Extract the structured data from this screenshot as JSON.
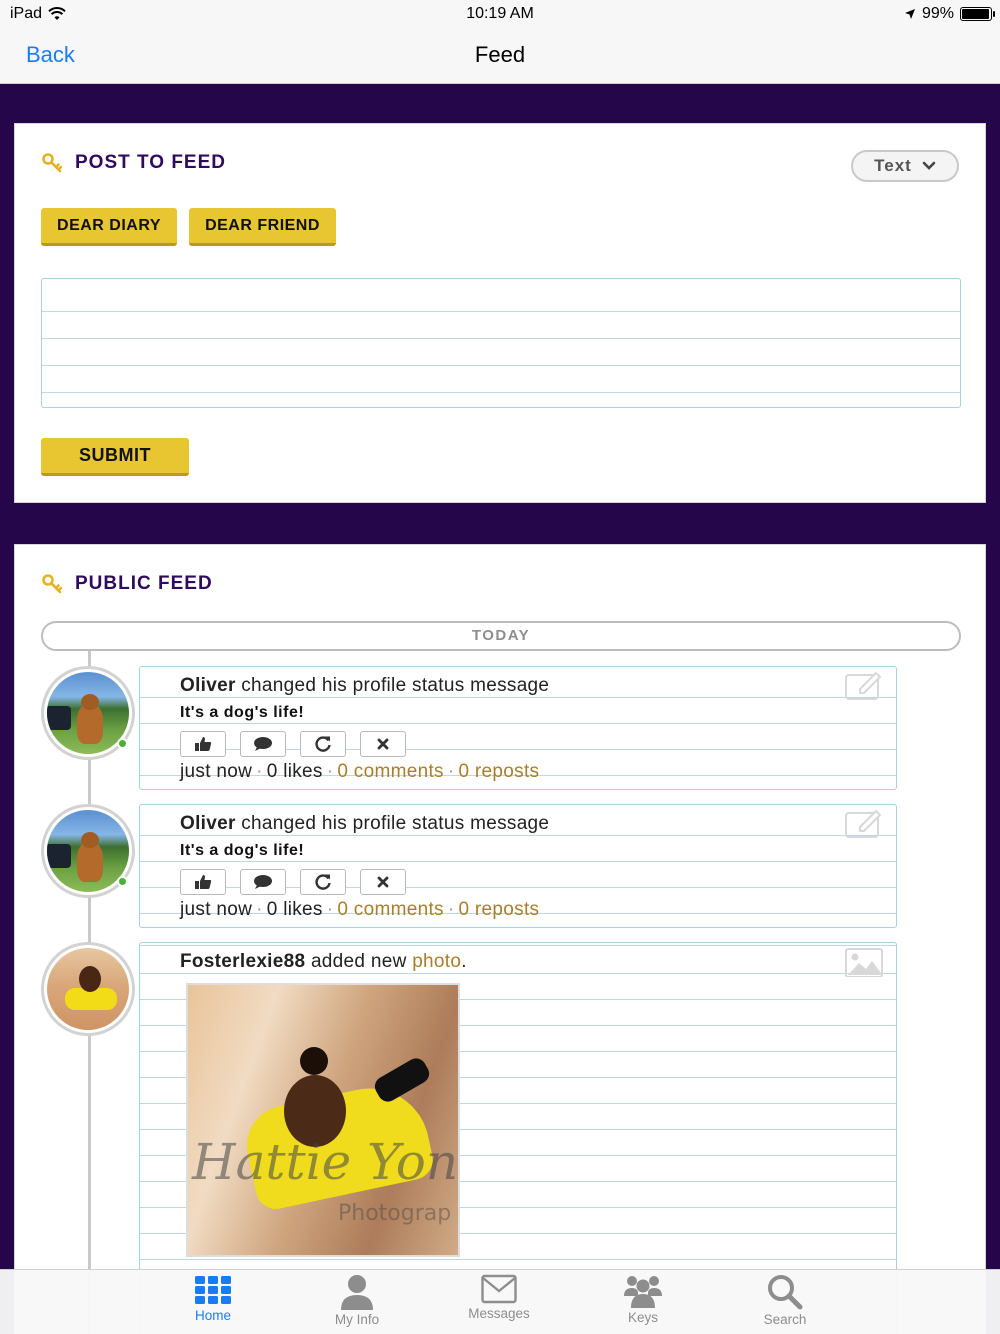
{
  "status_bar": {
    "device": "iPad",
    "time": "10:19 AM",
    "battery": "99%"
  },
  "nav": {
    "back_label": "Back",
    "title": "Feed"
  },
  "post_to_feed": {
    "title": "POST TO FEED",
    "type_select": "Text",
    "buttons": [
      "DEAR DIARY",
      "DEAR FRIEND"
    ],
    "textarea_placeholder": "",
    "submit_label": "SUBMIT"
  },
  "public_feed": {
    "title": "PUBLIC FEED",
    "today_label": "TODAY",
    "posts": [
      {
        "user": "Oliver",
        "action": " changed his profile status message",
        "status": "It's a dog's life!",
        "time": "just now",
        "likes": "0 likes",
        "comments": "0 comments",
        "reposts": "0 reposts",
        "online": true
      },
      {
        "user": "Oliver",
        "action": " changed his profile status message",
        "status": "It's a dog's life!",
        "time": "just now",
        "likes": "0 likes",
        "comments": "0 comments",
        "reposts": "0 reposts",
        "online": true
      },
      {
        "user": "Fosterlexie88",
        "action_prefix": " added new ",
        "action_link": "photo",
        "action_suffix": ".",
        "photo_watermark": "Hattie Yonan",
        "photo_watermark_2": "Photograp"
      }
    ]
  },
  "tab_bar": {
    "tabs": [
      {
        "label": "Home",
        "icon": "grid-icon",
        "active": true
      },
      {
        "label": "My Info",
        "icon": "person-icon",
        "active": false
      },
      {
        "label": "Messages",
        "icon": "envelope-icon",
        "active": false
      },
      {
        "label": "Keys",
        "icon": "group-icon",
        "active": false
      },
      {
        "label": "Search",
        "icon": "magnifier-icon",
        "active": false
      }
    ]
  },
  "colors": {
    "accent_blue": "#1a7cf5",
    "brand_purple": "#26064a",
    "button_yellow": "#e7c632",
    "link_gold": "#a87f2a",
    "online_green": "#47b233"
  }
}
